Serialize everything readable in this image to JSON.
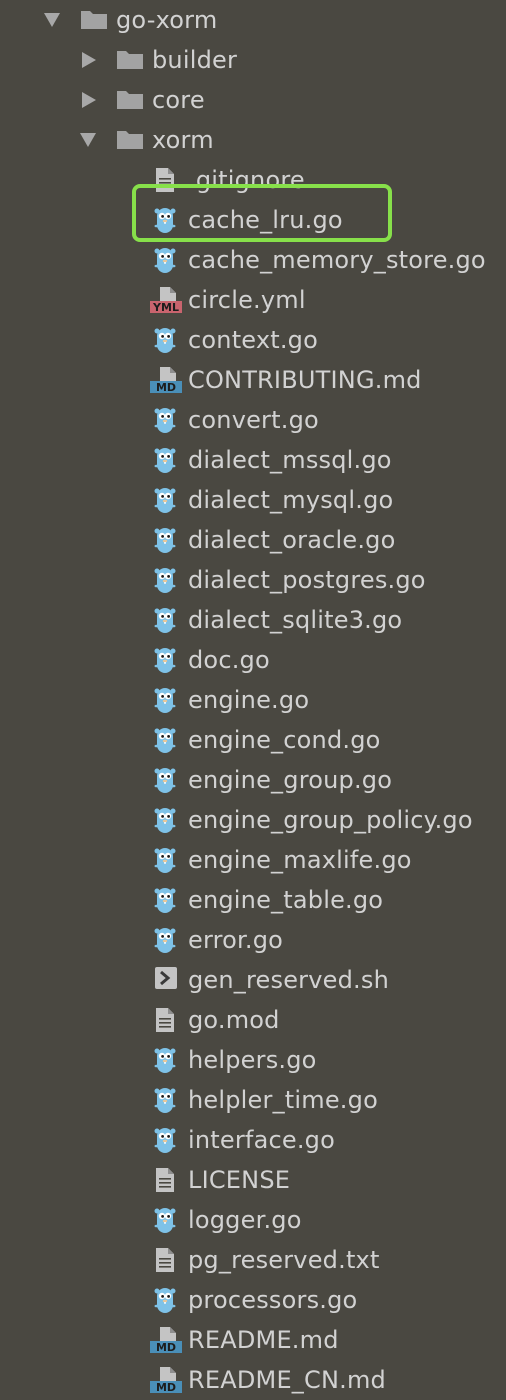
{
  "tree": {
    "root": {
      "label": "go-xorm",
      "icon": "folder-icon",
      "expanded": true
    },
    "folders": [
      {
        "label": "builder",
        "icon": "folder-icon",
        "expanded": false
      },
      {
        "label": "core",
        "icon": "folder-icon",
        "expanded": false
      },
      {
        "label": "xorm",
        "icon": "folder-icon",
        "expanded": true
      }
    ],
    "files": [
      {
        "label": ".gitignore",
        "icon": "text-file-icon"
      },
      {
        "label": "cache_lru.go",
        "icon": "go-gopher-icon",
        "highlighted": true
      },
      {
        "label": "cache_memory_store.go",
        "icon": "go-gopher-icon"
      },
      {
        "label": "circle.yml",
        "icon": "yml-file-icon",
        "badge": "YML"
      },
      {
        "label": "context.go",
        "icon": "go-gopher-icon"
      },
      {
        "label": "CONTRIBUTING.md",
        "icon": "md-file-icon",
        "badge": "MD"
      },
      {
        "label": "convert.go",
        "icon": "go-gopher-icon"
      },
      {
        "label": "dialect_mssql.go",
        "icon": "go-gopher-icon"
      },
      {
        "label": "dialect_mysql.go",
        "icon": "go-gopher-icon"
      },
      {
        "label": "dialect_oracle.go",
        "icon": "go-gopher-icon"
      },
      {
        "label": "dialect_postgres.go",
        "icon": "go-gopher-icon"
      },
      {
        "label": "dialect_sqlite3.go",
        "icon": "go-gopher-icon"
      },
      {
        "label": "doc.go",
        "icon": "go-gopher-icon"
      },
      {
        "label": "engine.go",
        "icon": "go-gopher-icon"
      },
      {
        "label": "engine_cond.go",
        "icon": "go-gopher-icon"
      },
      {
        "label": "engine_group.go",
        "icon": "go-gopher-icon"
      },
      {
        "label": "engine_group_policy.go",
        "icon": "go-gopher-icon"
      },
      {
        "label": "engine_maxlife.go",
        "icon": "go-gopher-icon"
      },
      {
        "label": "engine_table.go",
        "icon": "go-gopher-icon"
      },
      {
        "label": "error.go",
        "icon": "go-gopher-icon"
      },
      {
        "label": "gen_reserved.sh",
        "icon": "shell-script-icon"
      },
      {
        "label": "go.mod",
        "icon": "text-file-icon"
      },
      {
        "label": "helpers.go",
        "icon": "go-gopher-icon"
      },
      {
        "label": "helpler_time.go",
        "icon": "go-gopher-icon"
      },
      {
        "label": "interface.go",
        "icon": "go-gopher-icon"
      },
      {
        "label": "LICENSE",
        "icon": "text-file-icon"
      },
      {
        "label": "logger.go",
        "icon": "go-gopher-icon"
      },
      {
        "label": "pg_reserved.txt",
        "icon": "text-file-icon"
      },
      {
        "label": "processors.go",
        "icon": "go-gopher-icon"
      },
      {
        "label": "README.md",
        "icon": "md-file-icon",
        "badge": "MD"
      },
      {
        "label": "README_CN.md",
        "icon": "md-file-icon",
        "badge": "MD"
      }
    ]
  },
  "colors": {
    "background": "#4a4841",
    "text": "#d2d2d2",
    "folder": "#a3a3a3",
    "gopher": "#7ec2e8",
    "highlight": "#87e04a",
    "yml_badge": "#c9646e",
    "md_badge": "#4a8fb8"
  }
}
